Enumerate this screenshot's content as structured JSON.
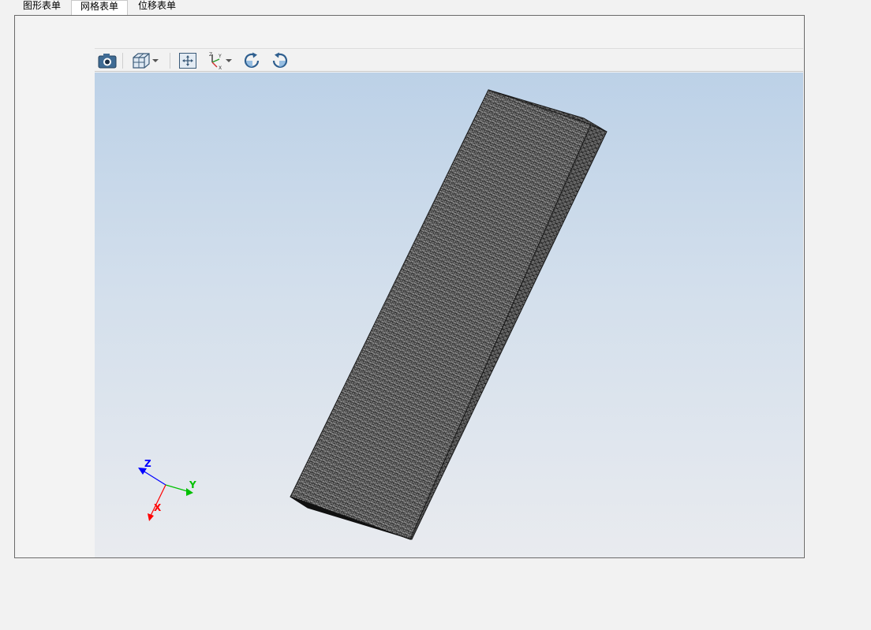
{
  "tabs": [
    {
      "label": "图形表单",
      "active": false
    },
    {
      "label": "网格表单",
      "active": true
    },
    {
      "label": "位移表单",
      "active": false
    }
  ],
  "toolbar": {
    "buttons": [
      {
        "name": "camera-icon"
      },
      {
        "name": "view-cube-icon",
        "dropdown": true
      },
      {
        "name": "fit-view-icon"
      },
      {
        "name": "axes-orientation-icon",
        "dropdown": true
      },
      {
        "name": "rotate-clockwise-icon"
      },
      {
        "name": "rotate-counterclockwise-icon"
      }
    ]
  },
  "axes_triad": {
    "z_label": "Z",
    "y_label": "Y",
    "x_label": "X",
    "colors": {
      "x": "#ff0000",
      "y": "#00c000",
      "z": "#0000ff"
    }
  },
  "mesh": {
    "edge_color": "#1a1a1a",
    "face_color": "#8f8f8f"
  }
}
